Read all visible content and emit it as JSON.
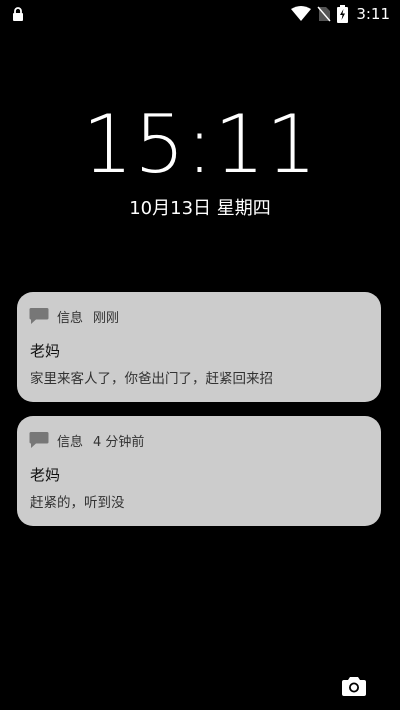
{
  "status_bar": {
    "time": "3:11",
    "icons": [
      "lock-icon",
      "wifi-icon",
      "no-sim-icon",
      "battery-charging-icon"
    ]
  },
  "lockscreen": {
    "clock": "15:11",
    "date": "10月13日 星期四"
  },
  "notifications": [
    {
      "app": "信息",
      "time": "刚刚",
      "title": "老妈",
      "body": "家里来客人了，你爸出门了，赶紧回来招"
    },
    {
      "app": "信息",
      "time": "4 分钟前",
      "title": "老妈",
      "body": "赶紧的，听到没"
    }
  ],
  "camera_shortcut_icon": "camera-icon",
  "colors": {
    "background": "#000000",
    "card": "#cccccc",
    "text_on_card": "#111111"
  }
}
